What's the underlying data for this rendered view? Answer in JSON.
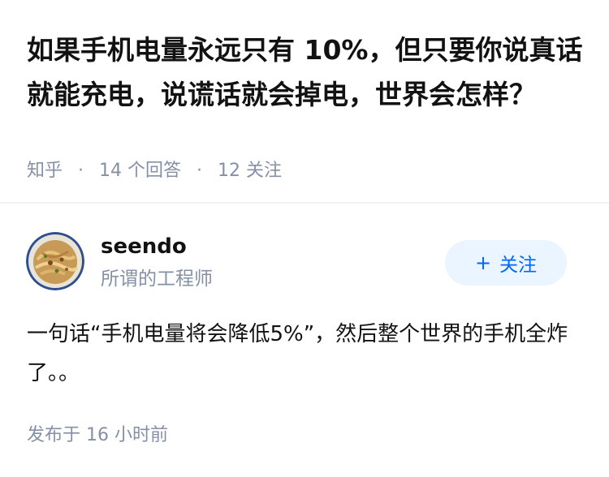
{
  "question": {
    "title": "如果手机电量永远只有 10%，但只要你说真话就能充电，说谎话就会掉电，世界会怎样？",
    "source": "知乎",
    "separator": "·",
    "answers_count": "14",
    "answers_unit": "个回答",
    "follow_count": "12",
    "follow_unit": "关注"
  },
  "answer": {
    "author": {
      "avatar_icon": "food-photo-avatar",
      "name": "seendo",
      "bio": "所谓的工程师"
    },
    "follow_button": {
      "plus": "+",
      "label": "关注"
    },
    "content": "一句话“手机电量将会降低5%”，然后整个世界的手机全炸了。。",
    "time_label": "发布于",
    "time_value": "16 小时前"
  },
  "colors": {
    "title": "#121212",
    "meta": "#8590a6",
    "accent": "#0066ff",
    "accent_bg": "#ebf5ff",
    "divider": "#f0f2f7"
  }
}
